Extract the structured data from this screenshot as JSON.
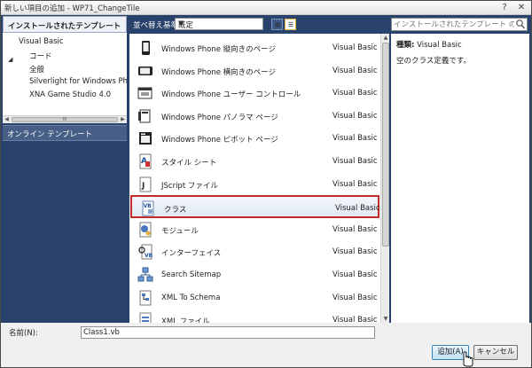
{
  "window": {
    "title": "新しい項目の追加 - WP71_ChangeTile",
    "help_label": "?",
    "close_label": "✕"
  },
  "left": {
    "header": "インストールされたテンプレート",
    "tree": [
      {
        "label": "Visual Basic",
        "level": 0,
        "expanded": true
      },
      {
        "label": "コード",
        "level": 1
      },
      {
        "label": "全般",
        "level": 1
      },
      {
        "label": "Silverlight for Windows Phone",
        "level": 1
      },
      {
        "label": "XNA Game Studio 4.0",
        "level": 1
      }
    ],
    "scroll_thumb_label": "III",
    "online_label": "オンライン テンプレート"
  },
  "toolbar": {
    "sort_label": "並べ替え基準:",
    "sort_value": "既定"
  },
  "items": [
    {
      "name": "Windows Phone 縦向きのページ",
      "lang": "Visual Basic",
      "icon": "phone-portrait-icon"
    },
    {
      "name": "Windows Phone 横向きのページ",
      "lang": "Visual Basic",
      "icon": "phone-landscape-icon"
    },
    {
      "name": "Windows Phone ユーザー コントロール",
      "lang": "Visual Basic",
      "icon": "user-control-icon"
    },
    {
      "name": "Windows Phone パノラマ ページ",
      "lang": "Visual Basic",
      "icon": "panorama-icon"
    },
    {
      "name": "Windows Phone ピボット ページ",
      "lang": "Visual Basic",
      "icon": "pivot-icon"
    },
    {
      "name": "スタイル シート",
      "lang": "Visual Basic",
      "icon": "stylesheet-icon"
    },
    {
      "name": "JScript ファイル",
      "lang": "Visual Basic",
      "icon": "jscript-icon"
    },
    {
      "name": "クラス",
      "lang": "Visual Basic",
      "icon": "class-icon",
      "selected": true
    },
    {
      "name": "モジュール",
      "lang": "Visual Basic",
      "icon": "module-icon"
    },
    {
      "name": "インターフェイス",
      "lang": "Visual Basic",
      "icon": "interface-icon"
    },
    {
      "name": "Search Sitemap",
      "lang": "Visual Basic",
      "icon": "sitemap-icon"
    },
    {
      "name": "XML To Schema",
      "lang": "Visual Basic",
      "icon": "xml-schema-icon"
    },
    {
      "name": "XML ファイル",
      "lang": "Visual Basic",
      "icon": "xml-file-icon"
    }
  ],
  "search": {
    "placeholder": "インストールされたテンプレート の検索"
  },
  "details": {
    "type_label": "種類:",
    "type_value": "Visual Basic",
    "description": "空のクラス定義です。"
  },
  "bottom": {
    "name_label": "名前(N):",
    "name_value": "Class1.vb",
    "add_label": "追加(A)",
    "cancel_label": "キャンセル"
  },
  "colors": {
    "accent_dark": "#29426b",
    "selection_border": "#c22b2b",
    "online_bg": "#475f86"
  }
}
